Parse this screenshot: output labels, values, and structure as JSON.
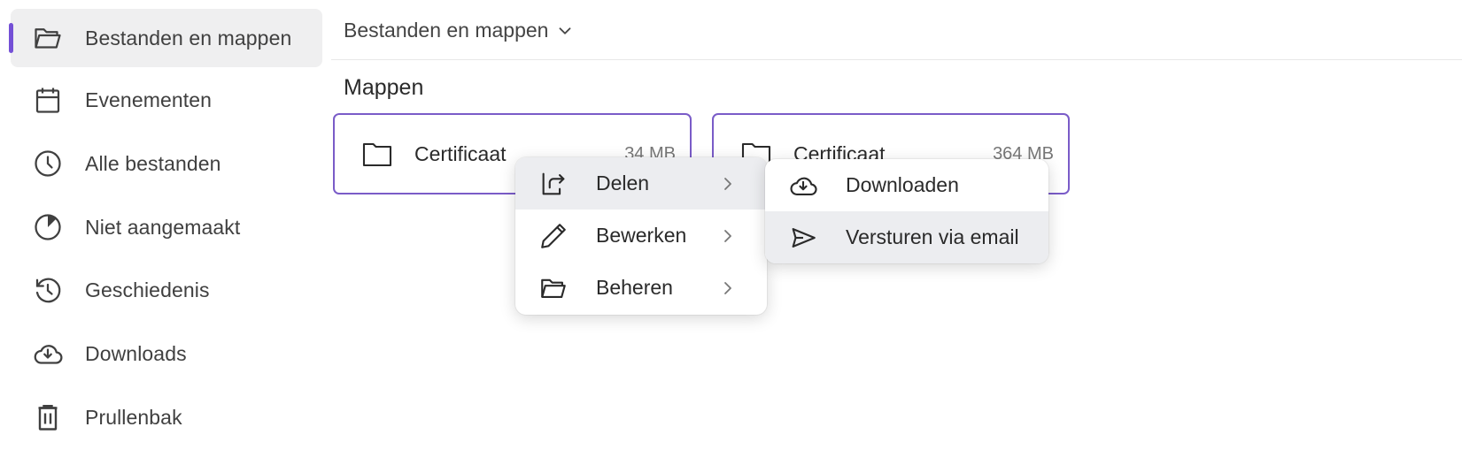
{
  "sidebar": {
    "items": [
      {
        "label": "Bestanden en mappen",
        "icon": "folder-open-icon",
        "active": true
      },
      {
        "label": "Evenementen",
        "icon": "calendar-icon",
        "active": false
      },
      {
        "label": "Alle bestanden",
        "icon": "clock-icon",
        "active": false
      },
      {
        "label": "Niet aangemaakt",
        "icon": "pie-chart-icon",
        "active": false
      },
      {
        "label": "Geschiedenis",
        "icon": "history-icon",
        "active": false
      },
      {
        "label": "Downloads",
        "icon": "cloud-download-icon",
        "active": false
      },
      {
        "label": "Prullenbak",
        "icon": "trash-icon",
        "active": false
      }
    ],
    "accent_color": "#7450d6"
  },
  "header": {
    "title": "Bestanden en mappen",
    "dropdown_icon": "chevron-down-icon"
  },
  "main": {
    "section_title": "Mappen",
    "folders": [
      {
        "name": "Certificaat",
        "size": "34 MB"
      },
      {
        "name": "Certificaat",
        "size": "364 MB"
      }
    ],
    "card_border_color": "#7a5cc8"
  },
  "context_menu": {
    "items": [
      {
        "label": "Delen",
        "icon": "share-icon",
        "has_submenu": true,
        "hovered": true
      },
      {
        "label": "Bewerken",
        "icon": "pencil-icon",
        "has_submenu": true,
        "hovered": false
      },
      {
        "label": "Beheren",
        "icon": "folder-open-icon",
        "has_submenu": true,
        "hovered": false
      }
    ]
  },
  "submenu": {
    "items": [
      {
        "label": "Downloaden",
        "icon": "cloud-download-icon",
        "hovered": false
      },
      {
        "label": "Versturen via email",
        "icon": "send-icon",
        "hovered": true
      }
    ]
  }
}
